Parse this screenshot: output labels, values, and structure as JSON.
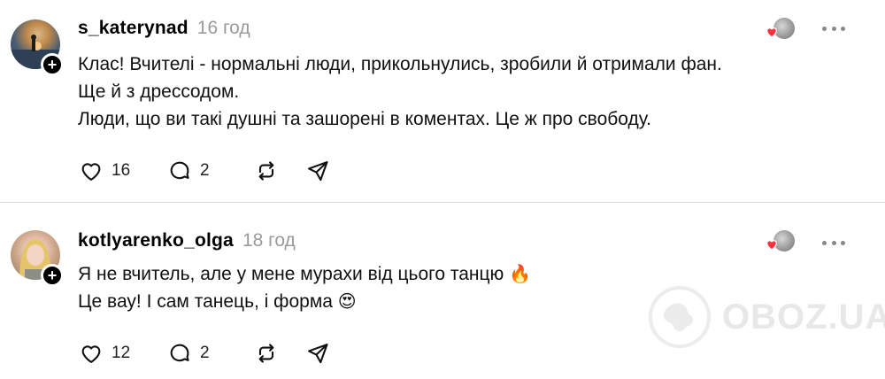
{
  "posts": [
    {
      "username": "s_katerynad",
      "time": "16 год",
      "lines": [
        "Клас! Вчителі - нормальні люди, прикольнулись, зробили й отримали фан.",
        "Ще й з дресcодом.",
        "Люди, що ви такі душні та зашорені в коментах. Це ж про свободу."
      ],
      "likes": "16",
      "comments": "2",
      "avatar_icon": "avatar-photo-sunset",
      "follow_badge": "+"
    },
    {
      "username": "kotlyarenko_olga",
      "time": "18 год",
      "lines": [
        "Я не вчитель, але у мене мурахи від цього танцю",
        "Це вау! І сам танець, і форма"
      ],
      "line_emojis": [
        "🔥",
        "😍"
      ],
      "likes": "12",
      "comments": "2",
      "avatar_icon": "avatar-photo-woman",
      "follow_badge": "+"
    }
  ],
  "watermark": {
    "text": "OBOZ.UA",
    "icon": "globe-logo-icon"
  },
  "colors": {
    "heart": "#ff3040",
    "muted": "#9a9a9a",
    "divider": "#dcdcdc",
    "watermark": "#e8e8e8"
  }
}
